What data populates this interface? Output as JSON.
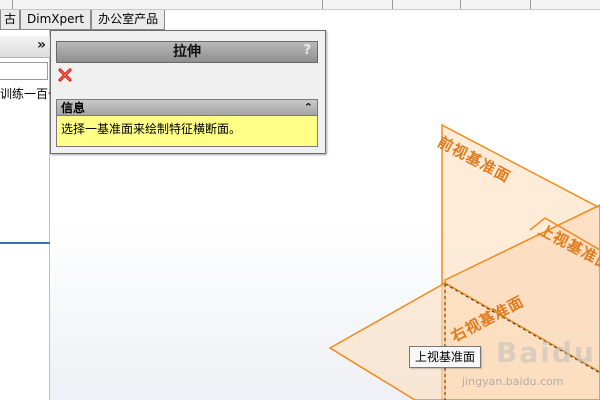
{
  "tabs": [
    "古",
    "DimXpert",
    "办公室产品"
  ],
  "left_panel": {
    "collapse_symbol": "»",
    "tree_item_text": "训练一百七"
  },
  "property_manager": {
    "title": "拉伸",
    "help_symbol": "?",
    "cancel_icon": "red-x-icon",
    "info_group": {
      "title": "信息",
      "collapse_symbol": "⌃",
      "message": "选择一基准面来绘制特征横断面。"
    }
  },
  "planes": {
    "front": "前视基准面",
    "top": "上视基准面",
    "right": "右视基准面"
  },
  "tooltip": "上视基准面",
  "watermark": {
    "logo": "Baidu",
    "url": "jingyan.baidu.com"
  },
  "colors": {
    "plane_fill": "#fde2c6",
    "plane_edge": "#f08a1c",
    "info_bg": "#ffff88",
    "cancel_red": "#d9261c"
  }
}
